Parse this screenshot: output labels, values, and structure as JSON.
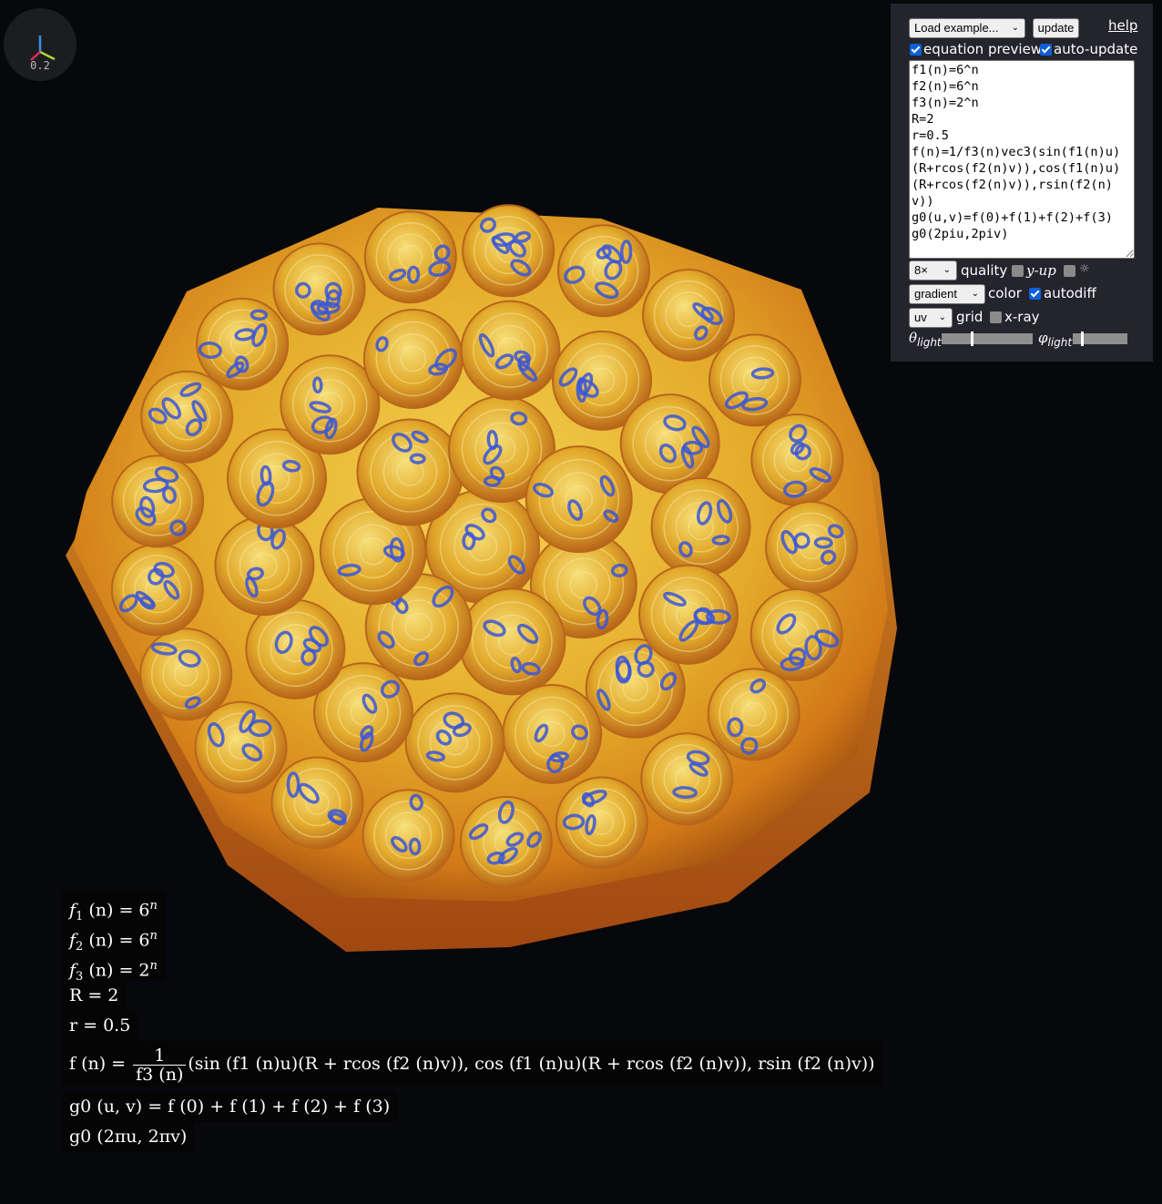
{
  "gizmo": {
    "zoom": "0.2",
    "axis_x_color": "#b6d42b",
    "axis_y_color": "#3e8ee6",
    "axis_z_color": "#e0285c"
  },
  "viewport": {
    "palette": {
      "base": "#d99a1e",
      "highlight": "#f3d350",
      "shadow": "#9a4a10",
      "accent": "#3a56d6"
    }
  },
  "panel": {
    "example_select": "Load example...",
    "update_button": "update",
    "help_link": "help",
    "equation_preview": {
      "label": "equation preview",
      "checked": true
    },
    "auto_update": {
      "label": "auto-update",
      "checked": true
    },
    "code": "f1(n)=6^n\nf2(n)=6^n\nf3(n)=2^n\nR=2\nr=0.5\nf(n)=1/f3(n)vec3(sin(f1(n)u)(R+rcos(f2(n)v)),cos(f1(n)u)(R+rcos(f2(n)v)),rsin(f2(n)v))\ng0(u,v)=f(0)+f(1)+f(2)+f(3)\ng0(2piu,2piv)",
    "quality_select": "8×",
    "quality_label": "quality",
    "yup": {
      "label": "y-up",
      "checked": false
    },
    "sun": {
      "label": "☼",
      "checked": false
    },
    "color_select": "gradient",
    "color_label": "color",
    "autodiff": {
      "label": "autodiff",
      "checked": true
    },
    "grid_select": "uv",
    "grid_label": "grid",
    "xray": {
      "label": "x-ray",
      "checked": false
    },
    "theta_label": "θ",
    "theta_sub": "light",
    "theta_value": 0.33,
    "phi_label": "φ",
    "phi_sub": "light",
    "phi_value": 0.18
  },
  "equations": {
    "f1": {
      "name": "f",
      "sub": "1",
      "rhs": "(n) = 6",
      "sup": "n"
    },
    "f2": {
      "name": "f",
      "sub": "2",
      "rhs": "(n) = 6",
      "sup": "n"
    },
    "f3": {
      "name": "f",
      "sub": "3",
      "rhs": "(n) = 2",
      "sup": "n"
    },
    "R": "R = 2",
    "r": "r = 0.5",
    "f_lhs": "f (n) =",
    "f_num": "1",
    "f_den": "f3 (n)",
    "f_rhs": "(sin (f1 (n)u)(R + rcos (f2 (n)v)), cos (f1 (n)u)(R + rcos (f2 (n)v)), rsin (f2 (n)v))",
    "g0_def": "g0 (u, v) = f (0) + f (1) + f (2) + f (3)",
    "g0_call": "g0 (2πu, 2πv)"
  }
}
